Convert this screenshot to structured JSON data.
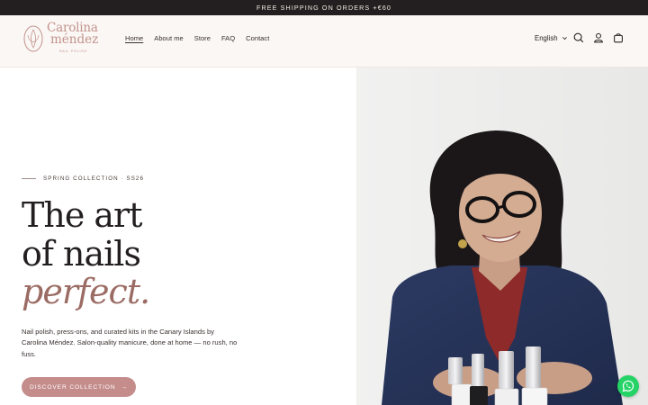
{
  "announcement": "FREE SHIPPING ON ORDERS +€60",
  "logo": {
    "line1": "Carolina",
    "line2": "méndez",
    "tagline": "NAIL POLISH"
  },
  "nav": {
    "items": [
      "Home",
      "About me",
      "Store",
      "FAQ",
      "Contact"
    ],
    "active": "Home"
  },
  "header_tools": {
    "language": "English",
    "icons": [
      "search-icon",
      "account-icon",
      "cart-icon"
    ]
  },
  "hero": {
    "eyebrow": "SPRING COLLECTION · SS26",
    "title_line1": "The art",
    "title_line2": "of nails",
    "title_line3": "perfect.",
    "description": "Nail polish, press-ons, and curated kits in the Canary Islands by Carolina Méndez. Salon-quality manicure, done at home — no rush, no fuss.",
    "cta_label": "DISCOVER COLLECTION",
    "cta_arrow": "→"
  },
  "floating": {
    "icon": "whatsapp-icon"
  },
  "colors": {
    "announcement_bg": "#231f20",
    "header_bg": "#fbf7f4",
    "accent": "#c48c8b",
    "italic_accent": "#9b6c64",
    "whatsapp": "#25d366"
  }
}
